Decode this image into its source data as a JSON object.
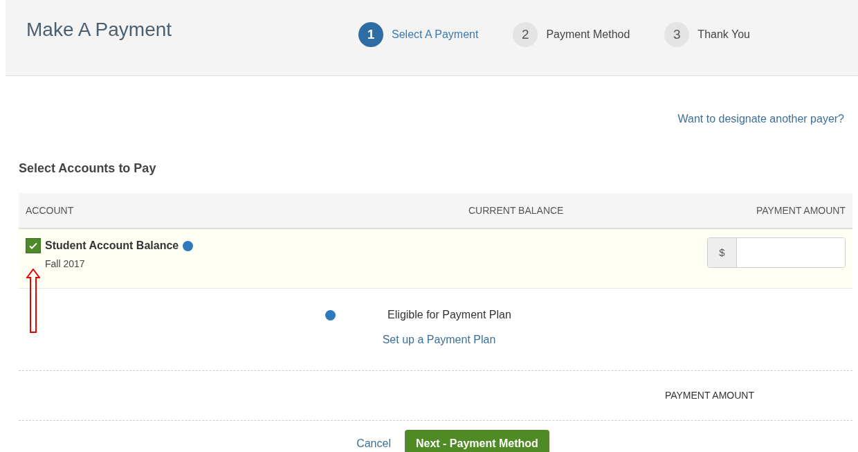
{
  "title": "Make A Payment",
  "steps": [
    {
      "number": "1",
      "label": "Select A Payment",
      "selected": true
    },
    {
      "number": "2",
      "label": "Payment Method",
      "selected": false
    },
    {
      "number": "3",
      "label": "Thank You",
      "selected": false
    }
  ],
  "payer_link": "Want to designate another payer?",
  "section_title": "Select Accounts to Pay",
  "table": {
    "columns": [
      "ACCOUNT",
      "CURRENT BALANCE",
      "PAYMENT AMOUNT"
    ],
    "rows": [
      {
        "name": "Student Account Balance",
        "term": "Fall 2017",
        "checked": true,
        "currency": "$"
      }
    ]
  },
  "plan": {
    "legend": "Eligible for Payment Plan",
    "link": "Set up a Payment Plan"
  },
  "total_label": "PAYMENT AMOUNT",
  "buttons": {
    "cancel": "Cancel",
    "next": "Next - Payment Method"
  }
}
